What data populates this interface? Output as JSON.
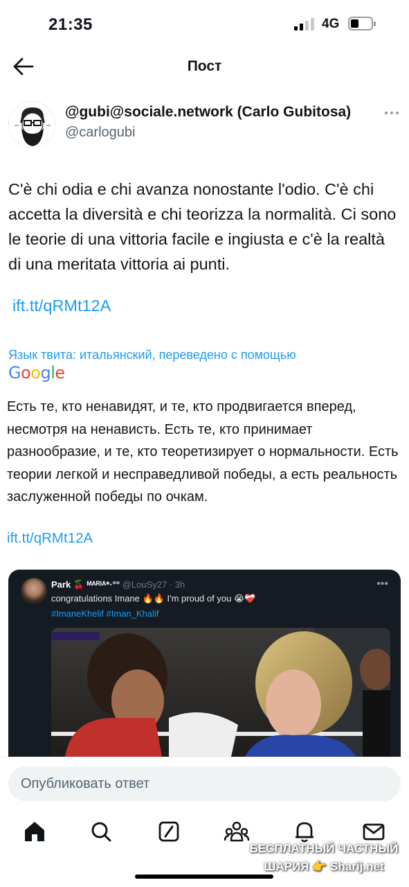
{
  "status_bar": {
    "time": "21:35",
    "network": "4G"
  },
  "header": {
    "title": "Пост"
  },
  "author": {
    "name": "@gubi@sociale.network (Carlo Gubitosa)",
    "handle": "@carlogubi"
  },
  "tweet": {
    "text": "C'è chi odia e chi avanza nonostante l'odio. C'è chi accetta la diversità e chi teorizza la normalità. Ci sono le teorie di una vittoria facile e ingiusta e c'è la realtà di una meritata vittoria ai punti.",
    "link": "ift.tt/qRMt12A"
  },
  "translation": {
    "note": "Язык твита: итальянский, переведено с помощью",
    "provider": "Google",
    "text": "Есть те, кто ненавидят, и те, кто продвигается вперед, несмотря на ненависть. Есть те, кто принимает разнообразие, и те, кто теоретизирует о нормальности. Есть теории легкой и несправедливой победы, а есть реальность заслуженной победы по очкам.",
    "link": "ift.tt/qRMt12A"
  },
  "embedded": {
    "name": "Park 🍒 ᴹᴬᴿᴵᴬ*·°°",
    "meta": "@LouSy27 · 3h",
    "text": "congratulations Imane 🔥🔥 I'm proud of you 😭❤️‍🩹",
    "tags": "#ImaneKhelif #Iman_Khalif"
  },
  "reply": {
    "placeholder": "Опубликовать ответ"
  },
  "watermark": {
    "line1": "БЕСПЛАТНЫЙ ЧАСТНЫЙ",
    "line2": "ШАРИЯ 👉 Sharij.net"
  },
  "colors": {
    "accent": "#1d9bf0",
    "text": "#0f1419",
    "muted": "#536471"
  },
  "icons": [
    "back-arrow-icon",
    "more-icon",
    "home-icon",
    "search-icon",
    "compose-icon",
    "communities-icon",
    "notifications-icon",
    "messages-icon"
  ]
}
